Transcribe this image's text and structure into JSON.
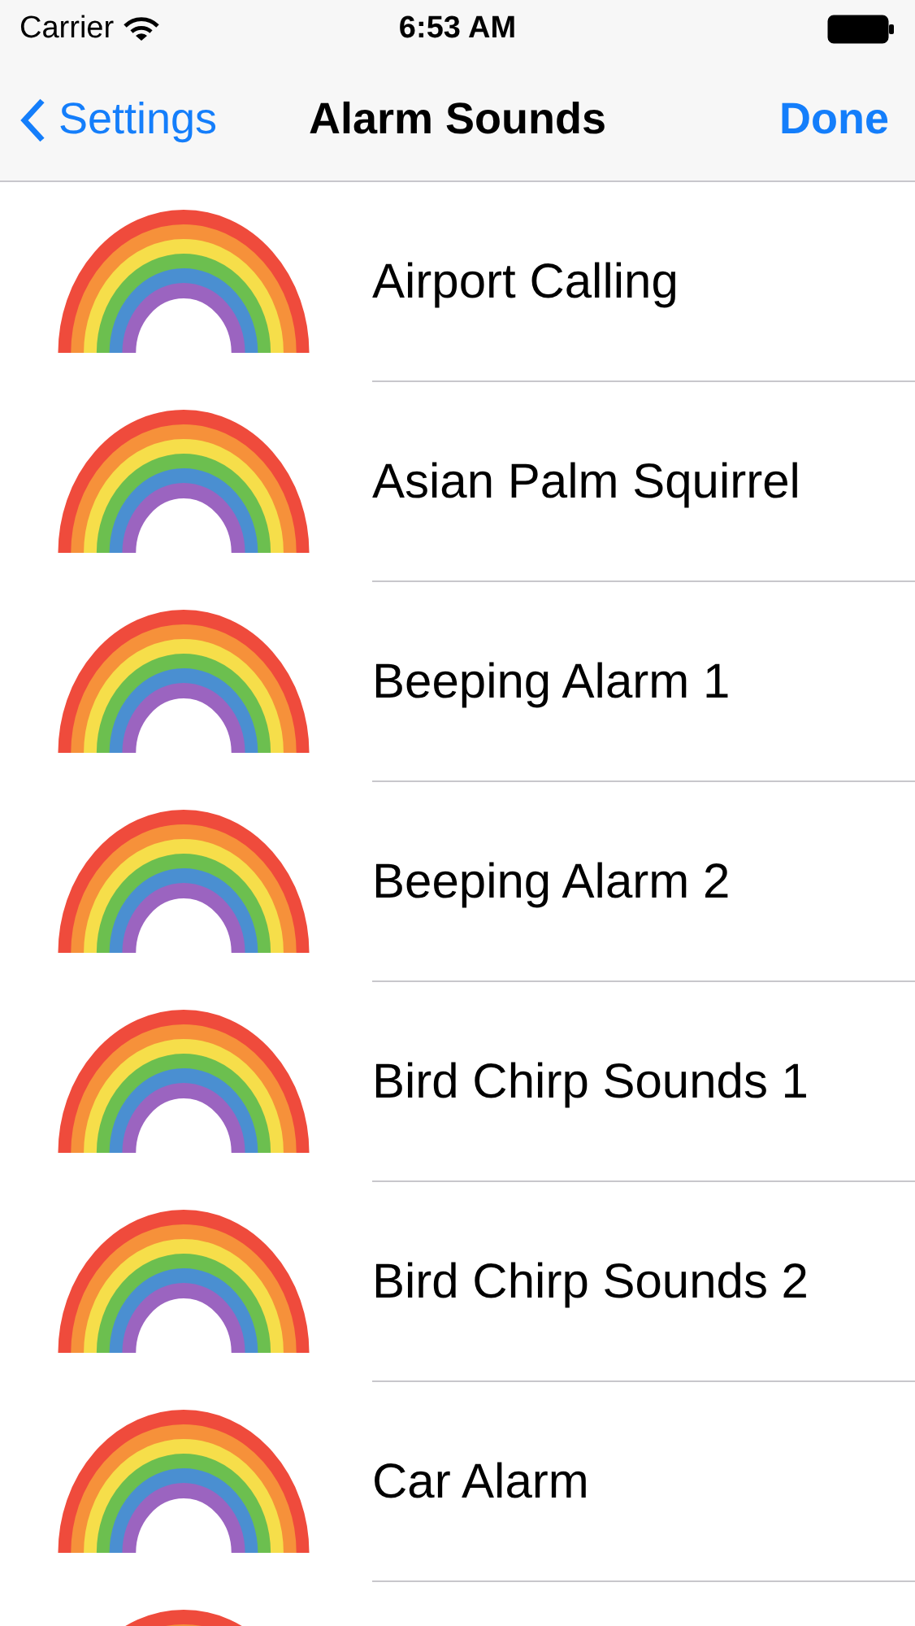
{
  "status_bar": {
    "carrier": "Carrier",
    "time": "6:53 AM"
  },
  "nav_bar": {
    "back": "Settings",
    "title": "Alarm Sounds",
    "done": "Done"
  },
  "sounds": [
    {
      "name": "Airport Calling"
    },
    {
      "name": "Asian Palm Squirrel"
    },
    {
      "name": "Beeping Alarm 1"
    },
    {
      "name": "Beeping Alarm 2"
    },
    {
      "name": "Bird Chirp Sounds 1"
    },
    {
      "name": "Bird Chirp Sounds 2"
    },
    {
      "name": "Car Alarm"
    }
  ]
}
